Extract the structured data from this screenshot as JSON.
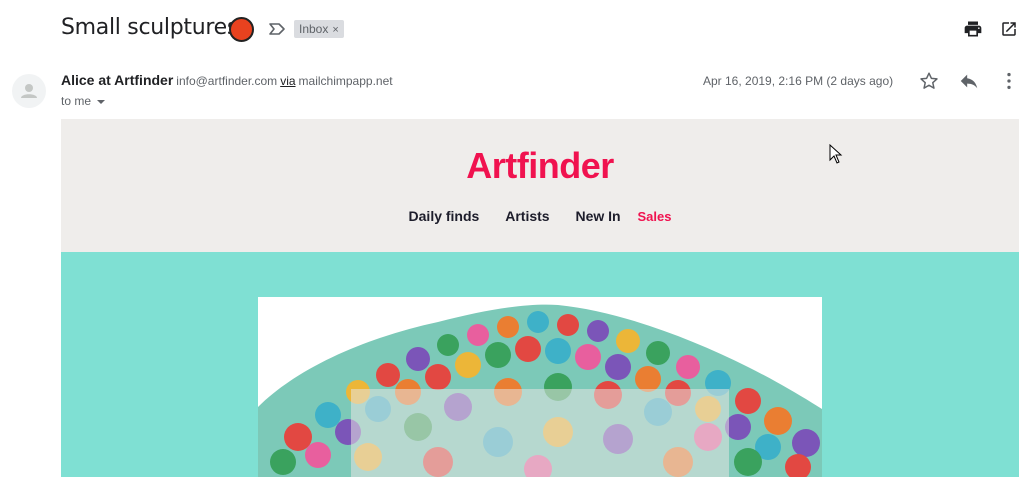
{
  "subject": "Small sculptures",
  "label_chip": {
    "text": "Inbox",
    "remove": "×"
  },
  "sender": {
    "name": "Alice at Artfinder",
    "email": "info@artfinder.com",
    "via_label": "via",
    "via_domain": "mailchimpapp.net",
    "recipient": "to me",
    "date": "Apr 16, 2019, 2:16 PM (2 days ago)"
  },
  "email": {
    "brand": "Artfinder",
    "nav": [
      "Daily finds",
      "Artists",
      "New In",
      "Sales"
    ]
  },
  "colors": {
    "brand": "#f0124f",
    "header_bg": "#efedeb",
    "hero_bg": "#7fe0d3",
    "importance_dot": "#e8421f"
  },
  "icons": [
    "label-icon",
    "print-icon",
    "popout-icon",
    "avatar-icon",
    "star-icon",
    "reply-icon",
    "more-vert-icon"
  ]
}
